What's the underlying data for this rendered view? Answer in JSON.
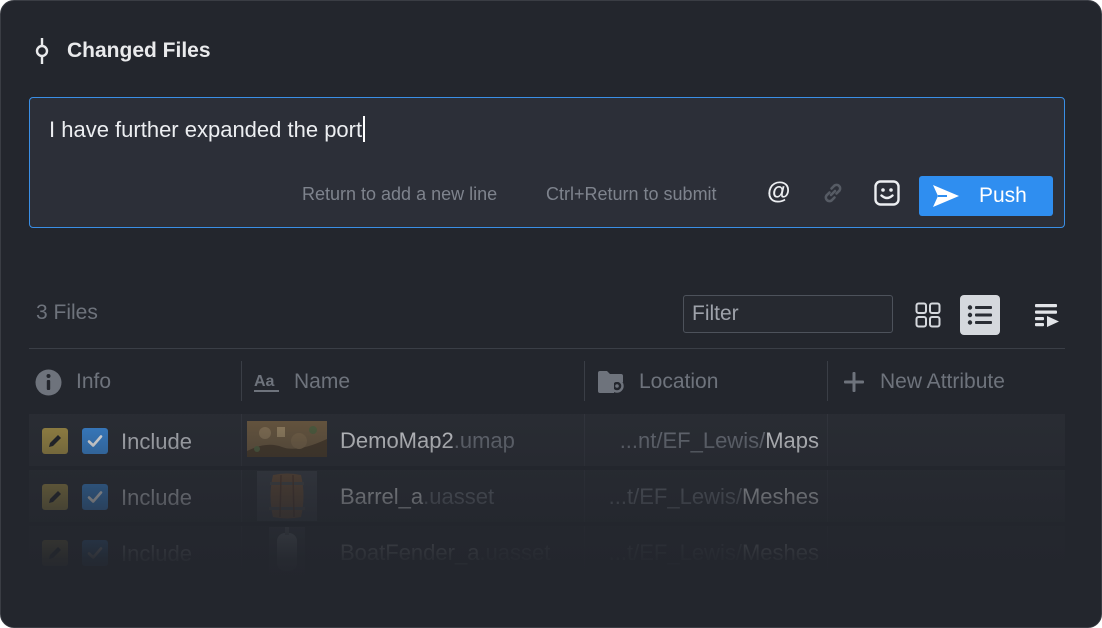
{
  "header": {
    "icon": "commit-icon",
    "title": "Changed Files"
  },
  "composer": {
    "message": "I have further expanded the port",
    "hint_newline": "Return to add a new line",
    "hint_submit": "Ctrl+Return to submit",
    "mention_label": "@",
    "link_icon": "link-icon",
    "emoji_icon": "smile-icon",
    "push_label": "Push",
    "accent_color": "#2f8ef0"
  },
  "toolbar": {
    "files_count": "3 Files",
    "filter_placeholder": "Filter",
    "view_modes": [
      "grid-view-icon",
      "list-view-icon",
      "columns-view-icon"
    ],
    "active_view": "list-view-icon"
  },
  "columns": {
    "info": "Info",
    "name": "Name",
    "location": "Location",
    "new_attribute": "New Attribute"
  },
  "rows": [
    {
      "include_label": "Include",
      "checked": true,
      "name_base": "DemoMap2",
      "name_ext": ".umap",
      "loc_path": "...nt/EF_Lewis/",
      "loc_leaf": "Maps"
    },
    {
      "include_label": "Include",
      "checked": true,
      "name_base": "Barrel_a",
      "name_ext": ".uasset",
      "loc_path": "...t/EF_Lewis/",
      "loc_leaf": "Meshes"
    },
    {
      "include_label": "Include",
      "checked": true,
      "name_base": "BoatFender_a",
      "name_ext": ".uasset",
      "loc_path": "...t/EF_Lewis/",
      "loc_leaf": "Meshes"
    }
  ]
}
